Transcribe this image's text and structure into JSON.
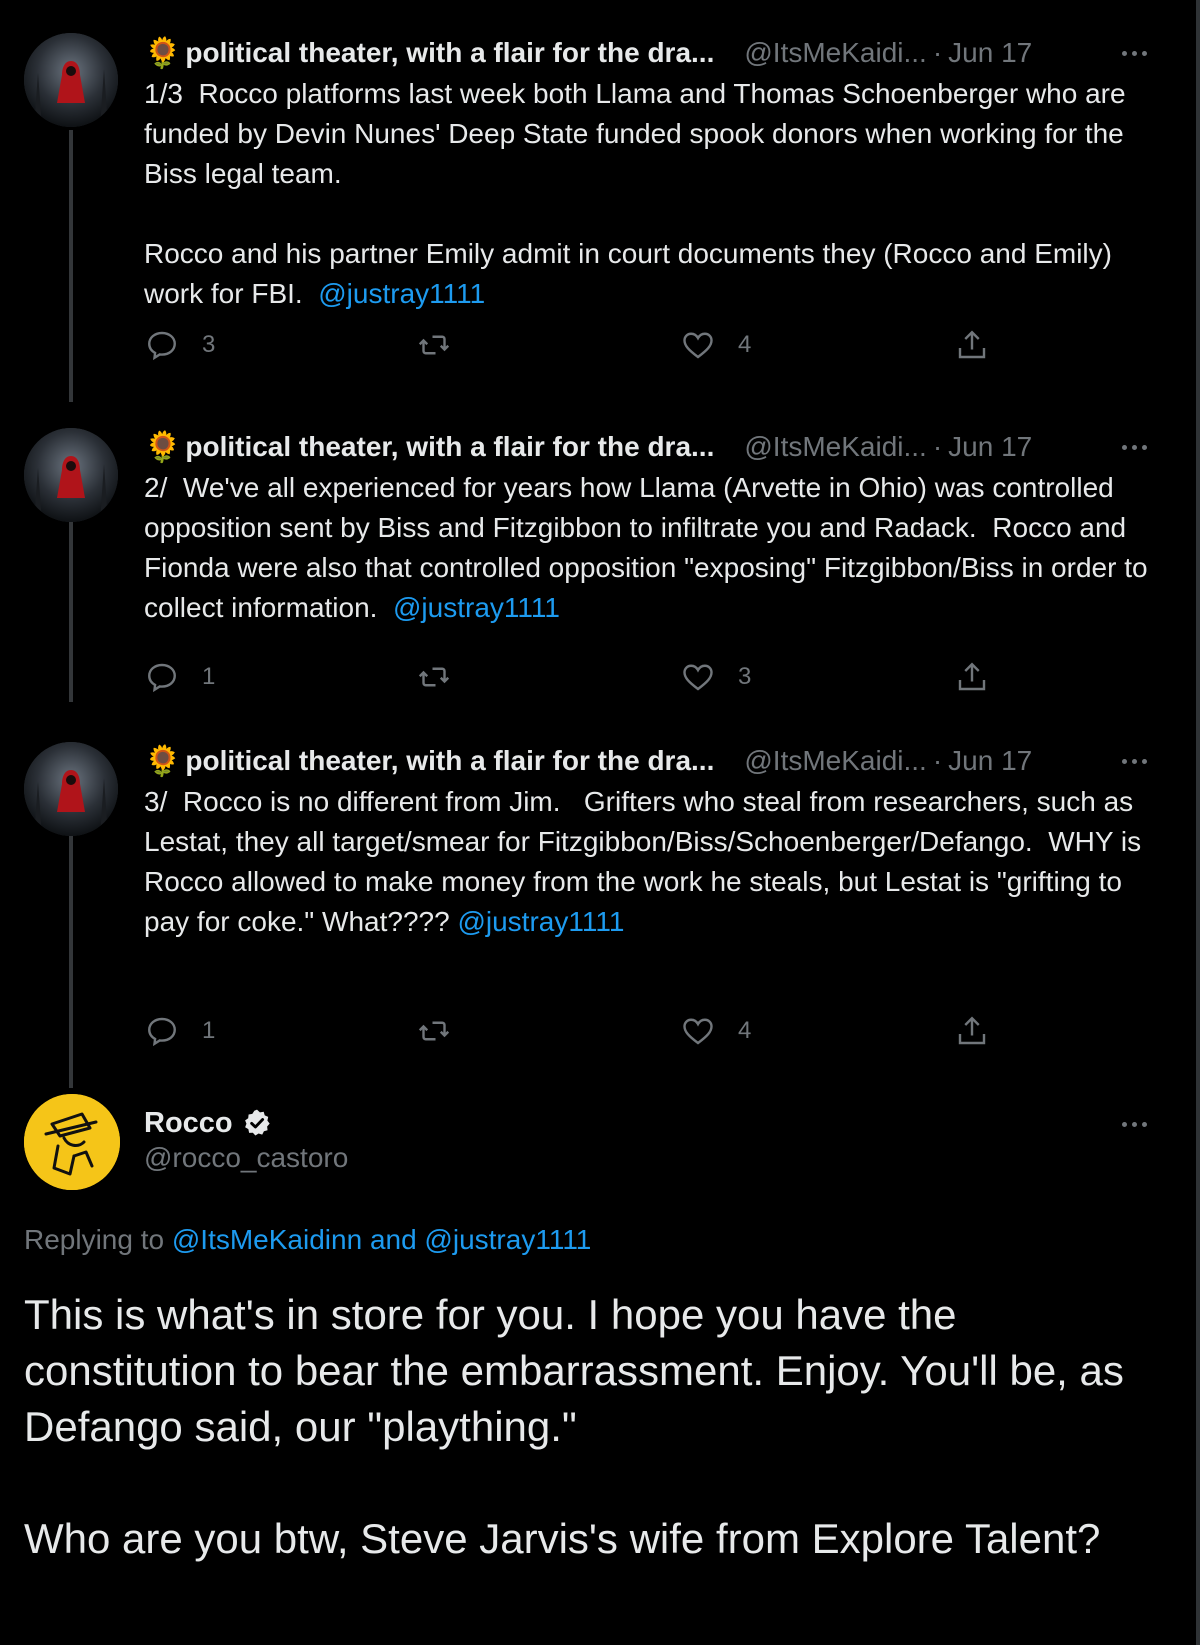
{
  "thread": [
    {
      "display_name": "political theater, with a flair for the dra...",
      "emoji": "🌻",
      "handle": "@ItsMeKaidi...",
      "date": "Jun 17",
      "text": "1/3  Rocco platforms last week both Llama and Thomas Schoenberger who are funded by Devin Nunes' Deep State funded spook donors when working for the Biss legal team.\n\nRocco and his partner Emily admit in court documents they (Rocco and Emily) work for FBI.  ",
      "mention": "@justray1111",
      "replies": "3",
      "retweets": "",
      "likes": "4"
    },
    {
      "display_name": "political theater, with a flair for the dra...",
      "emoji": "🌻",
      "handle": "@ItsMeKaidi...",
      "date": "Jun 17",
      "text": "2/  We've all experienced for years how Llama (Arvette in Ohio) was controlled opposition sent by Biss and Fitzgibbon to infiltrate you and Radack.  Rocco and Fionda were also that controlled opposition \"exposing\" Fitzgibbon/Biss in order to collect information.  ",
      "mention": "@justray1111",
      "replies": "1",
      "retweets": "",
      "likes": "3"
    },
    {
      "display_name": "political theater, with a flair for the dra...",
      "emoji": "🌻",
      "handle": "@ItsMeKaidi...",
      "date": "Jun 17",
      "text": "3/  Rocco is no different from Jim.   Grifters who steal from researchers, such as Lestat, they all target/smear for Fitzgibbon/Biss/Schoenberger/Defango.  WHY is Rocco allowed to make money from the work he steals, but Lestat is \"grifting to pay for coke.\" What???? ",
      "mention": "@justray1111",
      "replies": "1",
      "retweets": "",
      "likes": "4"
    }
  ],
  "main_tweet": {
    "display_name": "Rocco",
    "handle": "@rocco_castoro",
    "replying_prefix": "Replying to ",
    "replying_to": "@ItsMeKaidinn and @justray1111",
    "text": "This is what's in store for you. I hope you have the constitution to bear the embarrassment. Enjoy. You'll be, as Defango said, our \"plaything.\"\n\nWho are you btw, Steve Jarvis's wife from Explore Talent?"
  },
  "colors": {
    "background": "#000000",
    "text": "#e7e9ea",
    "muted": "#71767b",
    "link": "#1d9bf0",
    "avatar_yellow": "#f5c518"
  },
  "icons": [
    "reply-icon",
    "retweet-icon",
    "like-icon",
    "share-icon",
    "more-icon",
    "verified-icon"
  ]
}
